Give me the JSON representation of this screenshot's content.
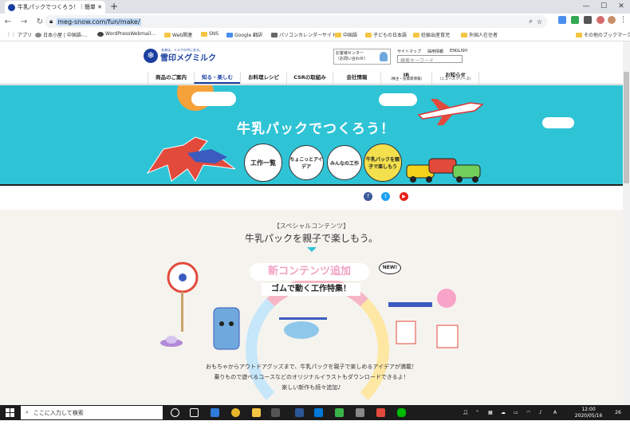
{
  "browser": {
    "tab_title": "牛乳パックでつくろう！｜簡単工作・自…",
    "url": "meg-snow.com/fun/make/",
    "new_tab_symbol": "+",
    "bookmarks": [
      "アプリ",
      "日本小屋 | 中国語-…",
      "WordPressWebmail…",
      "Web関連",
      "SNS",
      "Google 翻訳",
      "パソコンカレンダーサイト",
      "中国語",
      "子どもの日本語",
      "妊娠出産育児",
      "外国人在住者",
      "その他のブックマーク"
    ]
  },
  "site": {
    "logo_tagline": "未来は、ミルクの中にある。",
    "logo_name": "雪印メグミルク",
    "customer_center": "お客様センター",
    "customer_center_sub": "（お問い合わせ）",
    "top_links": [
      "サイトマップ",
      "採用情報",
      "ENGLISH"
    ],
    "search_placeholder": "検索キーワード",
    "nav": [
      {
        "label": "商品のご案内"
      },
      {
        "label": "知る・楽しむ"
      },
      {
        "label": "お料理レシピ"
      },
      {
        "label": "CSRの取組み"
      },
      {
        "label": "会社情報"
      },
      {
        "label": "IR",
        "sub": "（株主・投資家情報）"
      },
      {
        "label": "お知らせ",
        "sub": "（ニュースリリース）"
      }
    ]
  },
  "banner": {
    "title": "牛乳パックでつくろう！",
    "buttons": [
      "工作一覧",
      "ちょこっとアイデア",
      "みんなの工作",
      "牛乳パックを親子で楽しもう"
    ]
  },
  "special": {
    "subtitle": "【スペシャルコンテンツ】",
    "title": "牛乳パックを親子で楽しもう。",
    "promo_badge": "新コンテンツ追加",
    "promo_sub": "ゴムで動く工作特集！",
    "new_label": "NEW!",
    "desc1": "おもちゃからアウトドアグッズまで、牛乳パックを親子で楽しめるアイデアが満載！",
    "desc2": "乗りもので遊べるコースなどのオリジナルイラストもダウンロードできるよ！",
    "desc3": "楽しい新作も続々追加♪"
  },
  "taskbar": {
    "search_placeholder": "ここに入力して検索",
    "time": "12:00",
    "date": "2020/05/16",
    "ime": "A",
    "notifications": "26"
  },
  "colors": {
    "brand": "#1a3fa0",
    "banner": "#2fc3d6",
    "accent_pink": "#f2a1c3"
  }
}
